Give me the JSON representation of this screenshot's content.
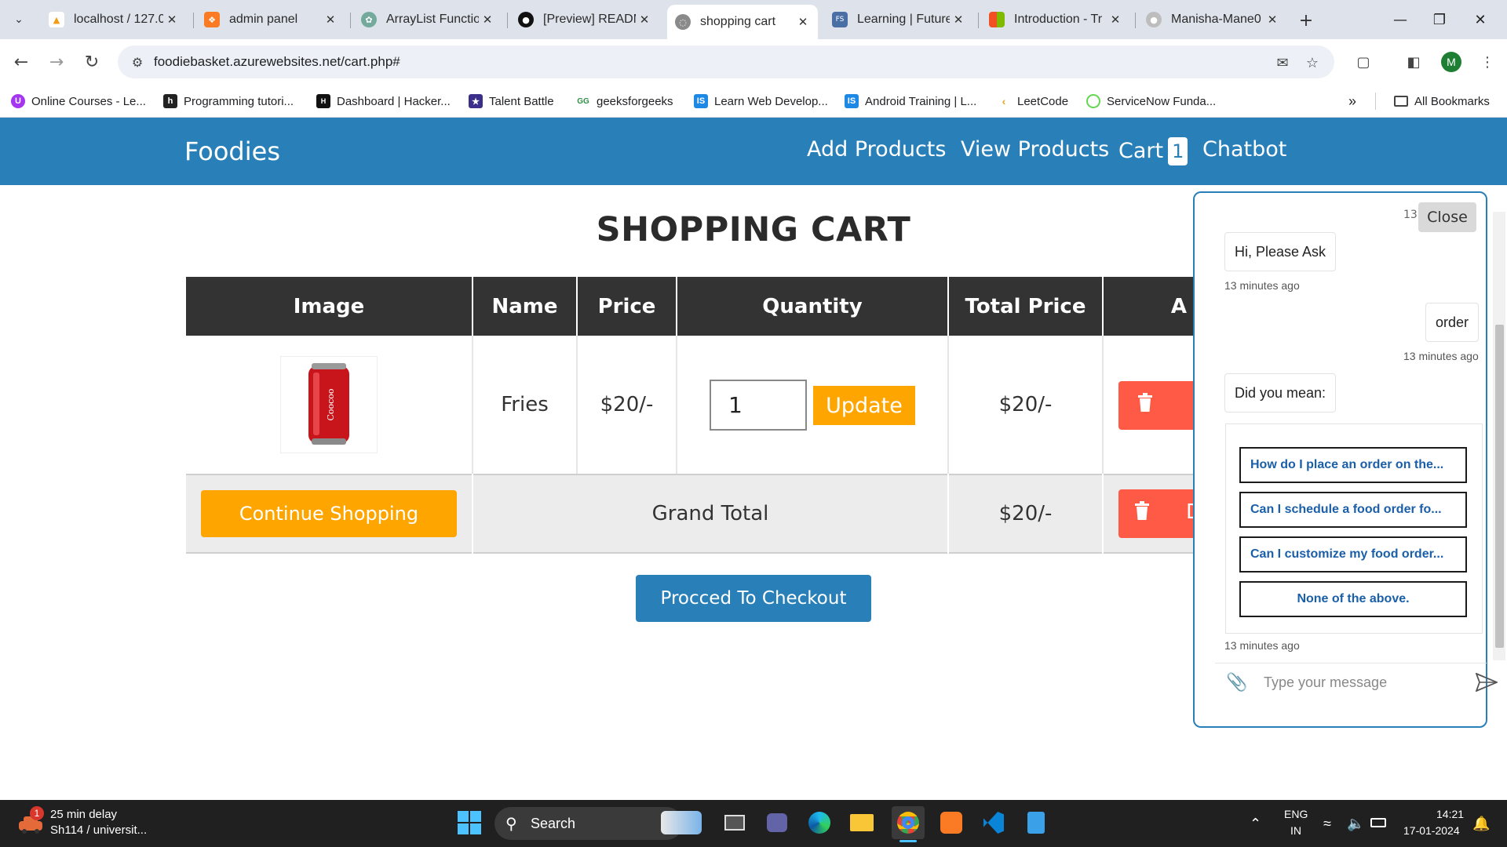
{
  "browser": {
    "tabs": [
      {
        "title": "localhost / 127.0",
        "favicon": "phpmyadmin-icon",
        "color": "#f39c12",
        "active": false
      },
      {
        "title": "admin panel",
        "favicon": "xampp-icon",
        "color": "#fb7a24",
        "active": false
      },
      {
        "title": "ArrayList Functio",
        "favicon": "chatgpt-icon",
        "color": "#74aa9c",
        "active": false
      },
      {
        "title": "[Preview] READM",
        "favicon": "github-icon",
        "color": "#111111",
        "active": false
      },
      {
        "title": "shopping cart",
        "favicon": "globe-icon",
        "color": "#7a7a7a",
        "active": true
      },
      {
        "title": "Learning | Future",
        "favicon": "futureskills-icon",
        "color": "#4a6fa5",
        "active": false
      },
      {
        "title": "Introduction - Tr",
        "favicon": "microsoft-icon",
        "color": "#f25022",
        "active": false
      },
      {
        "title": "Manisha-Mane0",
        "favicon": "github-icon",
        "color": "#bdbdbd",
        "active": false
      }
    ],
    "url": "foodiebasket.azurewebsites.net/cart.php#",
    "profile_initial": "M",
    "bookmarks": [
      {
        "label": "Online Courses - Le...",
        "icon": "udemy-icon",
        "color": "#a435f0"
      },
      {
        "label": "Programming tutori...",
        "icon": "hashnode-icon",
        "color": "#222222"
      },
      {
        "label": "Dashboard | Hacker...",
        "icon": "hackerrank-icon",
        "color": "#111111"
      },
      {
        "label": "Talent Battle",
        "icon": "talentbattle-icon",
        "color": "#3b2d8a"
      },
      {
        "label": "geeksforgeeks",
        "icon": "gfg-icon",
        "color": "#2f8d46"
      },
      {
        "label": "Learn Web Develop...",
        "icon": "is-icon",
        "color": "#1e88e5"
      },
      {
        "label": "Android Training | L...",
        "icon": "is-icon",
        "color": "#1e88e5"
      },
      {
        "label": "LeetCode",
        "icon": "leetcode-icon",
        "color": "#e7a41f"
      },
      {
        "label": "ServiceNow Funda...",
        "icon": "servicenow-icon",
        "color": "#62d84e"
      }
    ],
    "all_bookmarks_label": "All Bookmarks"
  },
  "site": {
    "brand": "Foodies",
    "nav": {
      "add_products": "Add Products",
      "view_products": "View Products",
      "cart": "Cart",
      "cart_count": "1",
      "chatbot": "Chatbot"
    },
    "accent_color": "#2980b9"
  },
  "cart": {
    "title": "SHOPPING CART",
    "headers": [
      "Image",
      "Name",
      "Price",
      "Quantity",
      "Total Price",
      "A"
    ],
    "items": [
      {
        "image_label": "Coocoo",
        "name": "Fries",
        "price": "$20/-",
        "quantity": "1",
        "total": "$20/-"
      }
    ],
    "update_label": "Update",
    "delete_label": "D",
    "continue_label": "Continue Shopping",
    "grand_total_label": "Grand Total",
    "grand_total_value": "$20/-",
    "checkout_label": "Procced To Checkout"
  },
  "chatbot": {
    "close_label": "Close",
    "top_timestamp": "13",
    "messages": [
      {
        "from": "bot",
        "text": "Hi, Please Ask",
        "time": "13 minutes ago"
      },
      {
        "from": "user",
        "text": "order",
        "time": "13 minutes ago"
      },
      {
        "from": "bot",
        "text": "Did you mean:",
        "time": ""
      }
    ],
    "suggestions": [
      "How do I place an order on the...",
      "Can I schedule a food order fo...",
      "Can I customize my food order...",
      "None of the above."
    ],
    "suggestions_time": "13 minutes ago",
    "input_placeholder": "Type your message"
  },
  "taskbar": {
    "weather_title": "25 min delay",
    "weather_sub": "Sh114 / universit...",
    "weather_badge": "1",
    "search_label": "Search",
    "lang_line1": "ENG",
    "lang_line2": "IN",
    "time": "14:21",
    "date": "17-01-2024"
  }
}
